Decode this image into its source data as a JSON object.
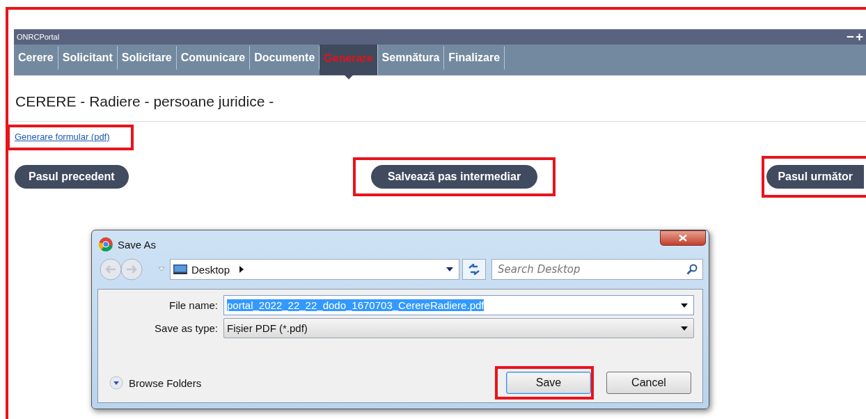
{
  "portal": {
    "title": "ONRCPortal",
    "window_controls": [
      "−",
      "+"
    ]
  },
  "tabs": [
    {
      "label": "Cerere",
      "selected": false
    },
    {
      "label": "Solicitant",
      "selected": false
    },
    {
      "label": "Solicitare",
      "selected": false
    },
    {
      "label": "Comunicare",
      "selected": false
    },
    {
      "label": "Documente",
      "selected": false
    },
    {
      "label": "Generare",
      "selected": true
    },
    {
      "label": "Semnătura",
      "selected": false
    },
    {
      "label": "Finalizare",
      "selected": false
    }
  ],
  "heading": "CERERE - Radiere - persoane juridice -",
  "link": {
    "label": "Generare formular (pdf)",
    "highlighted": true
  },
  "buttons": [
    {
      "label": "Pasul precedent",
      "highlighted": false
    },
    {
      "label": "Salvează pas intermediar",
      "highlighted": true
    },
    {
      "label": "Pasul următor",
      "highlighted": true
    }
  ],
  "dialog": {
    "title": "Save As",
    "location": "Desktop",
    "search": {
      "placeholder": "Search Desktop"
    },
    "fields": [
      {
        "label": "File name:",
        "value": "portal_2022_22_22_dodo_1670703_CerereRadiere.pdf",
        "kind": "text"
      },
      {
        "label": "Save as type:",
        "value": "Fișier PDF (*.pdf)",
        "kind": "select"
      }
    ],
    "browse": "Browse Folders",
    "buttons": [
      {
        "label": "Save",
        "highlighted": true
      },
      {
        "label": "Cancel",
        "highlighted": false
      }
    ]
  }
}
